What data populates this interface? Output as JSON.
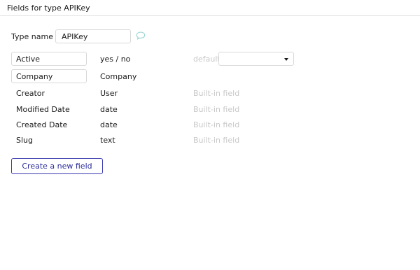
{
  "panel": {
    "title": "Fields for type APIKey"
  },
  "type_name": {
    "label": "Type name",
    "value": "APIKey",
    "comment_icon": "speech-bubble-icon"
  },
  "fields": [
    {
      "name": "Active",
      "type": "yes / no",
      "note": "default",
      "editable": true,
      "default_value": ""
    },
    {
      "name": "Company",
      "type": "Company",
      "note": "",
      "editable": true
    },
    {
      "name": "Creator",
      "type": "User",
      "note": "Built-in field",
      "editable": false
    },
    {
      "name": "Modified Date",
      "type": "date",
      "note": "Built-in field",
      "editable": false
    },
    {
      "name": "Created Date",
      "type": "date",
      "note": "Built-in field",
      "editable": false
    },
    {
      "name": "Slug",
      "type": "text",
      "note": "Built-in field",
      "editable": false
    }
  ],
  "actions": {
    "create_label": "Create a new field"
  },
  "colors": {
    "accent": "#2c2c9a",
    "muted": "#c8c8c8",
    "border": "#d9d9d9"
  }
}
